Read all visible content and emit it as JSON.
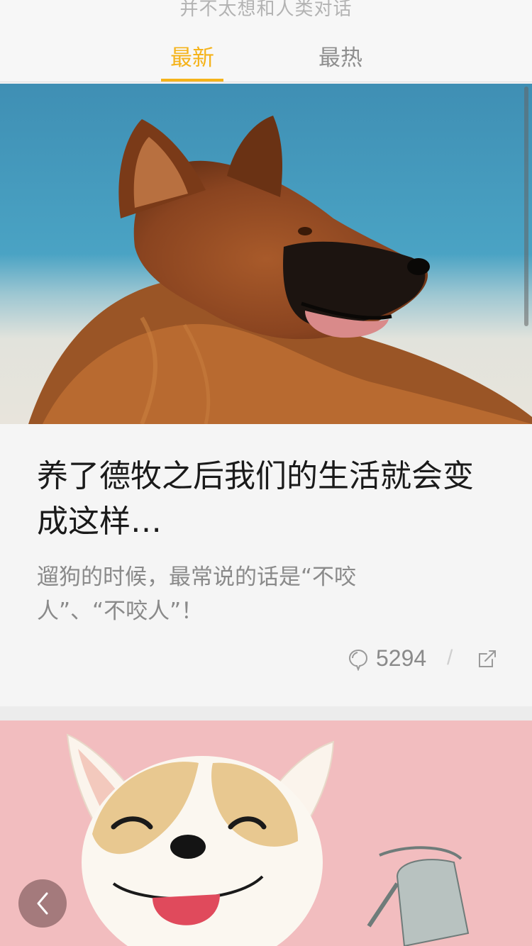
{
  "header": {
    "subtitle": "并不太想和人类对话",
    "tabs": [
      {
        "label": "最新",
        "active": true
      },
      {
        "label": "最热",
        "active": false
      }
    ],
    "accent_color": "#f5b31a"
  },
  "articles": [
    {
      "image": "german-shepherd-photo",
      "title": "养了德牧之后我们的生活就会变成这样…",
      "summary": "遛狗的时候，最常说的话是“不咬人”、“不咬人”！",
      "comment_count": "5294",
      "separator": "/",
      "icons": [
        "comment-icon",
        "share-icon"
      ]
    },
    {
      "image": "cartoon-dog-illustration"
    }
  ],
  "nav": {
    "back_icon": "chevron-left-icon"
  }
}
